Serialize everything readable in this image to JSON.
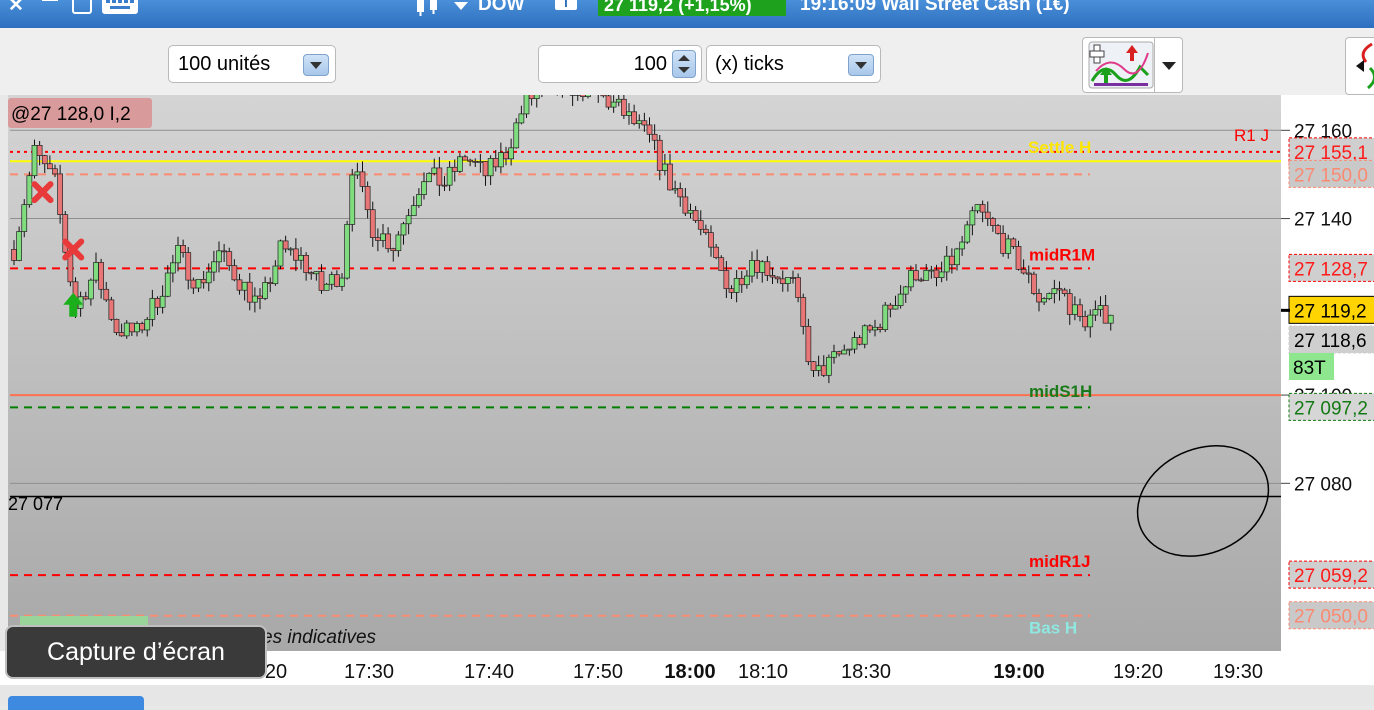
{
  "topbar": {
    "symbol": "DOW",
    "price_change": "27 119,2 (+1,15%)",
    "time_and_name": "19:16:09  Wall Street Cash (1€)"
  },
  "toolbar": {
    "units_value": "100 unités",
    "ticks_count": "100",
    "ticks_unit": "(x) ticks"
  },
  "chart_data": {
    "type": "candlestick",
    "instrument": "Wall Street Cash (1€)",
    "last_price": 27119.2,
    "ylim": [
      27042,
      27168
    ],
    "x_ticks": [
      {
        "label": "20",
        "bold": false
      },
      {
        "label": "17:30",
        "bold": false
      },
      {
        "label": "17:40",
        "bold": false
      },
      {
        "label": "17:50",
        "bold": false
      },
      {
        "label": "18:00",
        "bold": true
      },
      {
        "label": "18:10",
        "bold": false
      },
      {
        "label": "18:30",
        "bold": false
      },
      {
        "label": "19:00",
        "bold": true
      },
      {
        "label": "19:20",
        "bold": false
      },
      {
        "label": "19:30",
        "bold": false
      }
    ],
    "y_ticks": [
      {
        "value": 27160,
        "label": "27 160"
      },
      {
        "value": 27140,
        "label": "27 140"
      },
      {
        "value": 27100,
        "label": "27 100"
      },
      {
        "value": 27080,
        "label": "27 080"
      }
    ],
    "close_path": [
      [
        0,
        27133
      ],
      [
        2,
        27155
      ],
      [
        4,
        27148
      ],
      [
        5,
        27133
      ],
      [
        6,
        27120
      ],
      [
        8,
        27128
      ],
      [
        10,
        27115
      ],
      [
        12,
        27114
      ],
      [
        14,
        27122
      ],
      [
        16,
        27132
      ],
      [
        18,
        27125
      ],
      [
        20,
        27132
      ],
      [
        22,
        27126
      ],
      [
        24,
        27120
      ],
      [
        26,
        27133
      ],
      [
        28,
        27131
      ],
      [
        30,
        27124
      ],
      [
        32,
        27128
      ],
      [
        33,
        27152
      ],
      [
        35,
        27138
      ],
      [
        37,
        27134
      ],
      [
        40,
        27150
      ],
      [
        42,
        27148
      ],
      [
        44,
        27154
      ],
      [
        46,
        27150
      ],
      [
        48,
        27155
      ],
      [
        50,
        27167
      ],
      [
        52,
        27169
      ],
      [
        55,
        27170
      ],
      [
        57,
        27168
      ],
      [
        59,
        27165
      ],
      [
        62,
        27158
      ],
      [
        64,
        27148
      ],
      [
        66,
        27142
      ],
      [
        68,
        27132
      ],
      [
        70,
        27124
      ],
      [
        72,
        27131
      ],
      [
        74,
        27128
      ],
      [
        76,
        27125
      ],
      [
        78,
        27104
      ],
      [
        80,
        27108
      ],
      [
        82,
        27112
      ],
      [
        84,
        27115
      ],
      [
        86,
        27122
      ],
      [
        88,
        27128
      ],
      [
        90,
        27126
      ],
      [
        92,
        27132
      ],
      [
        94,
        27142
      ],
      [
        96,
        27136
      ],
      [
        98,
        27130
      ],
      [
        100,
        27122
      ],
      [
        102,
        27124
      ],
      [
        104,
        27117
      ],
      [
        106,
        27118
      ],
      [
        107,
        27119.2
      ]
    ],
    "levels": [
      {
        "value": 27155.1,
        "name": "",
        "price_label": "27 155,1",
        "color": "#ff0000",
        "style": "dotted"
      },
      {
        "value": 27155.1,
        "name": "R1 J",
        "price_label": "",
        "color": "#ff0000",
        "style": "none"
      },
      {
        "value": 27153,
        "name": "Settle H",
        "price_label": "",
        "color": "#ffff00",
        "style": "solid"
      },
      {
        "value": 27150,
        "name": "",
        "price_label": "27 150,0",
        "color": "#fa8a72",
        "style": "dashed"
      },
      {
        "value": 27128.7,
        "name": "midR1M",
        "price_label": "27 128,7",
        "color": "#ff0000",
        "style": "dashed"
      },
      {
        "value": 27119.2,
        "name": "",
        "price_label": "27 119,2",
        "color": "#ffd400",
        "style": "current"
      },
      {
        "value": 27118.6,
        "name": "",
        "price_label": "27 118,6",
        "color": "#c8c8c8",
        "style": "none"
      },
      {
        "value": 27100,
        "name": "midS1H",
        "price_label": "",
        "color": "#ff7050",
        "style": "solid"
      },
      {
        "value": 27097.2,
        "name": "",
        "price_label": "27 097,2",
        "color": "#008000",
        "style": "dashed"
      },
      {
        "value": 27077,
        "name": "",
        "price_label": "",
        "color": "#000000",
        "style": "solid"
      },
      {
        "value": 27059.2,
        "name": "midR1J",
        "price_label": "27 059,2",
        "color": "#ff0000",
        "style": "dashed"
      },
      {
        "value": 27050,
        "name": "Bas H",
        "price_label": "27 050,0",
        "color": "#fa8a72",
        "style": "dashed"
      }
    ],
    "tick_badge": "83T",
    "crosshair_label": "@27 128,0 I,2",
    "line_077_label": "27 077",
    "indicative_note": "es indicatives",
    "annotations": [
      {
        "type": "sell-marker",
        "x": 2,
        "price": 27146
      },
      {
        "type": "sell-marker",
        "x": 5,
        "price": 27133
      },
      {
        "type": "buy-arrow",
        "x": 5,
        "price": 27120
      },
      {
        "type": "ellipse",
        "x": 116,
        "price": 27076
      }
    ]
  },
  "capture": {
    "label": "Capture d’écran"
  },
  "colors": {
    "bullish": "#7fdc7f",
    "bearish": "#e87676",
    "chart_bg_top": "#d4d4d4",
    "chart_bg_bottom": "#a8a8a8"
  },
  "icons": [
    "close-icon",
    "minimize-icon",
    "window-icon",
    "keyboard-icon",
    "candlestick-icon",
    "dropdown-arrow-icon",
    "info-icon",
    "indicator-tool-icon",
    "order-flow-icon"
  ]
}
